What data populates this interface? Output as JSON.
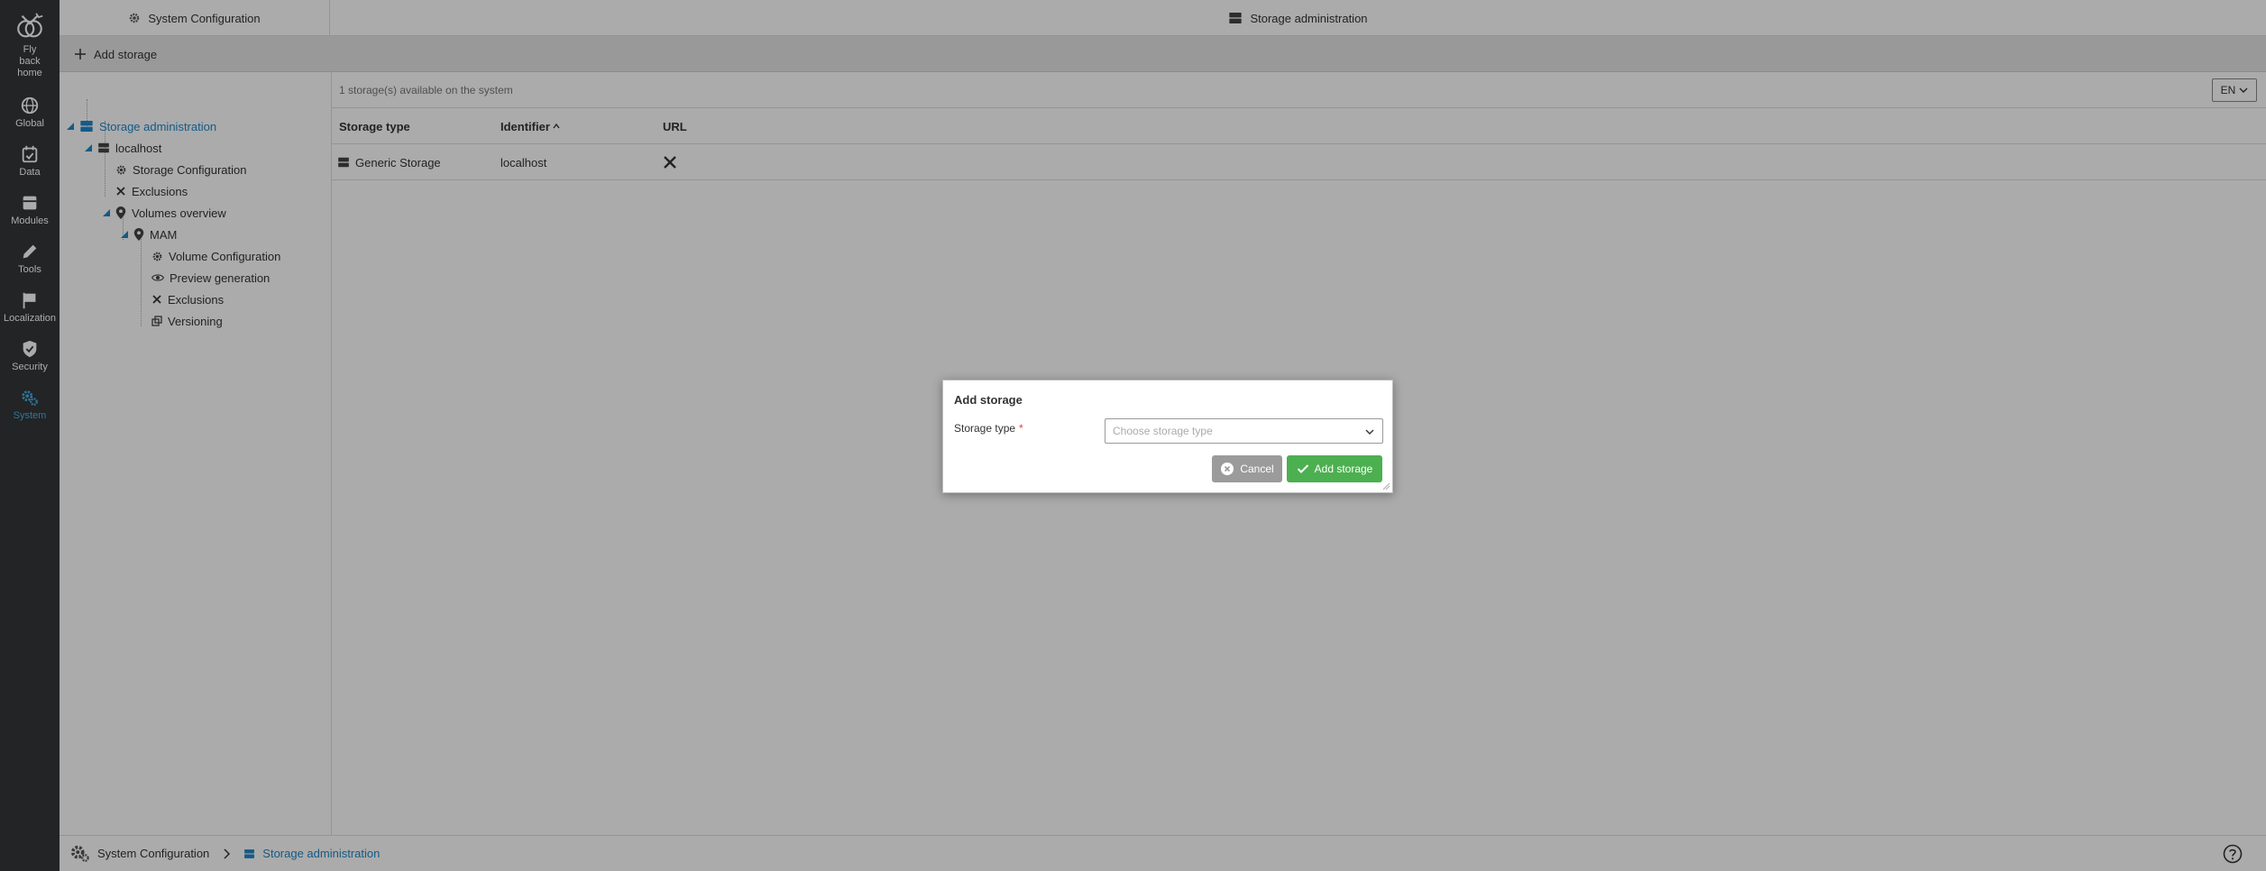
{
  "nav": {
    "items": [
      {
        "label": "Fly back home",
        "icon": "fly-back-home-icon"
      },
      {
        "label": "Global",
        "icon": "globe-icon"
      },
      {
        "label": "Data",
        "icon": "calendar-check-icon"
      },
      {
        "label": "Modules",
        "icon": "modules-icon"
      },
      {
        "label": "Tools",
        "icon": "pencil-icon"
      },
      {
        "label": "Localization",
        "icon": "flag-icon"
      },
      {
        "label": "Security",
        "icon": "shield-check-icon"
      },
      {
        "label": "System",
        "icon": "gears-icon",
        "active": true
      }
    ]
  },
  "header": {
    "left_title": "System Configuration",
    "center_title": "Storage administration"
  },
  "toolbar": {
    "add_storage_label": "Add storage"
  },
  "tree": {
    "root": "Storage administration",
    "localhost": "localhost",
    "storage_configuration": "Storage Configuration",
    "exclusions": "Exclusions",
    "volumes_overview": "Volumes overview",
    "mam": "MAM",
    "volume_configuration": "Volume Configuration",
    "preview_generation": "Preview generation",
    "mam_exclusions": "Exclusions",
    "versioning": "Versioning"
  },
  "content": {
    "info_text": "1 storage(s) available on the system",
    "language": "EN",
    "columns": {
      "storage_type": "Storage type",
      "identifier": "Identifier",
      "url": "URL"
    },
    "rows": [
      {
        "storage_type": "Generic Storage",
        "identifier": "localhost",
        "url_icon": "x-icon"
      }
    ]
  },
  "breadcrumb": {
    "first": "System Configuration",
    "second": "Storage administration"
  },
  "dialog": {
    "title": "Add storage",
    "field_label": "Storage type",
    "required_mark": "*",
    "select_placeholder": "Choose storage type",
    "cancel_label": "Cancel",
    "add_label": "Add storage"
  },
  "colors": {
    "sidebar_bg": "#333638",
    "active_blue": "#4ab2e5",
    "link_blue": "#1e88c9",
    "add_green": "#4caf50",
    "cancel_grey": "#9b9b9b"
  }
}
